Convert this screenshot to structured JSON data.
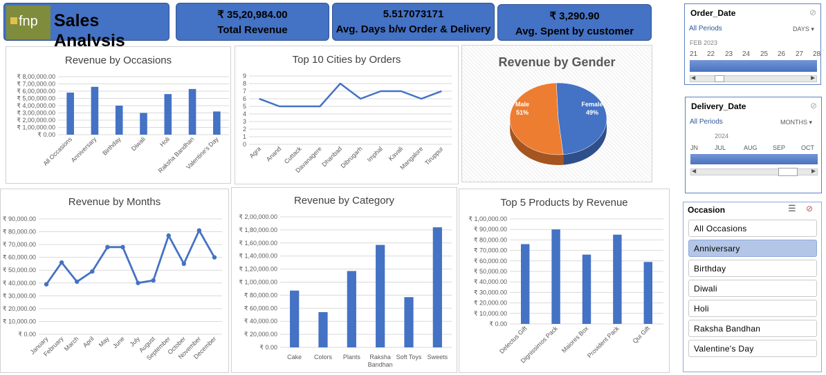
{
  "header": {
    "logo_text": "fnp",
    "title": "Sales Analysis"
  },
  "kpis": [
    {
      "value": "₹ 35,20,984.00",
      "label": "Total Revenue"
    },
    {
      "value": "5.517073171",
      "label": "Avg.  Days b/w Order & Delivery"
    },
    {
      "value": "₹ 3,290.90",
      "label": "Avg. Spent by customer"
    }
  ],
  "colors": {
    "bar": "#4472c4",
    "kpi": "#4472c4",
    "male": "#ed7d31",
    "female": "#4472c4",
    "slicer_selected": "#b4c6e7"
  },
  "slicers": {
    "order_date": {
      "title": "Order_Date",
      "period": "All Periods",
      "unit": "DAYS",
      "month_label": "FEB 2023",
      "days": [
        "21",
        "22",
        "23",
        "24",
        "25",
        "26",
        "27",
        "28"
      ]
    },
    "delivery_date": {
      "title": "Delivery_Date",
      "period": "All Periods",
      "unit": "MONTHS",
      "year_label": "2024",
      "months": [
        "JN",
        "JUL",
        "AUG",
        "SEP",
        "OCT"
      ]
    },
    "occasion": {
      "title": "Occasion",
      "items": [
        "All Occasions",
        "Anniversary",
        "Birthday",
        "Diwali",
        "Holi",
        "Raksha Bandhan",
        "Valentine's Day"
      ],
      "selected": "Anniversary"
    }
  },
  "chart_data": [
    {
      "id": "occasions",
      "type": "bar",
      "title": "Revenue by Occasions",
      "categories": [
        "All Occasions",
        "Anniversary",
        "Birthday",
        "Diwali",
        "Holi",
        "Raksha Bandhan",
        "Valentine's Day"
      ],
      "values": [
        580000,
        660000,
        400000,
        300000,
        560000,
        630000,
        320000
      ],
      "ylim": [
        0,
        800000
      ],
      "yticks": [
        "₹ 0.00",
        "₹ 1,00,000.00",
        "₹ 2,00,000.00",
        "₹ 3,00,000.00",
        "₹ 4,00,000.00",
        "₹ 5,00,000.00",
        "₹ 6,00,000.00",
        "₹ 7,00,000.00",
        "₹ 8,00,000.00"
      ]
    },
    {
      "id": "cities",
      "type": "line",
      "title": "Top 10 Cities by Orders",
      "categories": [
        "Agra",
        "Anand",
        "Cuttack",
        "Davanagere",
        "Dhanbad",
        "Dibrugarh",
        "Imphal",
        "Kavali",
        "Mangalore",
        "Tiruppur"
      ],
      "values": [
        6,
        5,
        5,
        5,
        8,
        6,
        7,
        7,
        6,
        7
      ],
      "ylim": [
        0,
        9
      ],
      "yticks": [
        "0",
        "1",
        "2",
        "3",
        "4",
        "5",
        "6",
        "7",
        "8",
        "9"
      ]
    },
    {
      "id": "gender",
      "type": "pie",
      "title": "Revenue by Gender",
      "labels": [
        "Male",
        "Female"
      ],
      "values": [
        51,
        49
      ],
      "value_labels": [
        "51%",
        "49%"
      ]
    },
    {
      "id": "months",
      "type": "line",
      "title": "Revenue by Months",
      "categories": [
        "January",
        "February",
        "March",
        "April",
        "May",
        "June",
        "July",
        "August",
        "September",
        "October",
        "November",
        "December"
      ],
      "values": [
        39000,
        56000,
        41000,
        49000,
        68000,
        68000,
        40000,
        42000,
        77000,
        55000,
        81000,
        60000
      ],
      "ylim": [
        0,
        90000
      ],
      "yticks": [
        "₹ 0.00",
        "₹ 10,000.00",
        "₹ 20,000.00",
        "₹ 30,000.00",
        "₹ 40,000.00",
        "₹ 50,000.00",
        "₹ 60,000.00",
        "₹ 70,000.00",
        "₹ 80,000.00",
        "₹ 90,000.00"
      ]
    },
    {
      "id": "category",
      "type": "bar",
      "title": "Revenue by Category",
      "categories": [
        "Cake",
        "Colors",
        "Plants",
        "Raksha Bandhan",
        "Soft Toys",
        "Sweets"
      ],
      "values": [
        87000,
        54000,
        117000,
        157000,
        77000,
        184000
      ],
      "ylim": [
        0,
        200000
      ],
      "yticks": [
        "₹ 0.00",
        "₹ 20,000.00",
        "₹ 40,000.00",
        "₹ 60,000.00",
        "₹ 80,000.00",
        "₹ 1,00,000.00",
        "₹ 1,20,000.00",
        "₹ 1,40,000.00",
        "₹ 1,60,000.00",
        "₹ 1,80,000.00",
        "₹ 2,00,000.00"
      ]
    },
    {
      "id": "products",
      "type": "bar",
      "title": "Top 5  Products by Revenue",
      "categories": [
        "Delectus Gift",
        "Dignissimos Pack",
        "Maiores Box",
        "Provident Pack",
        "Qui Gift"
      ],
      "values": [
        76000,
        90000,
        66000,
        85000,
        59000
      ],
      "ylim": [
        0,
        100000
      ],
      "yticks": [
        "₹ 0.00",
        "₹ 10,000.00",
        "₹ 20,000.00",
        "₹ 30,000.00",
        "₹ 40,000.00",
        "₹ 50,000.00",
        "₹ 60,000.00",
        "₹ 70,000.00",
        "₹ 80,000.00",
        "₹ 90,000.00",
        "₹ 1,00,000.00"
      ]
    }
  ]
}
